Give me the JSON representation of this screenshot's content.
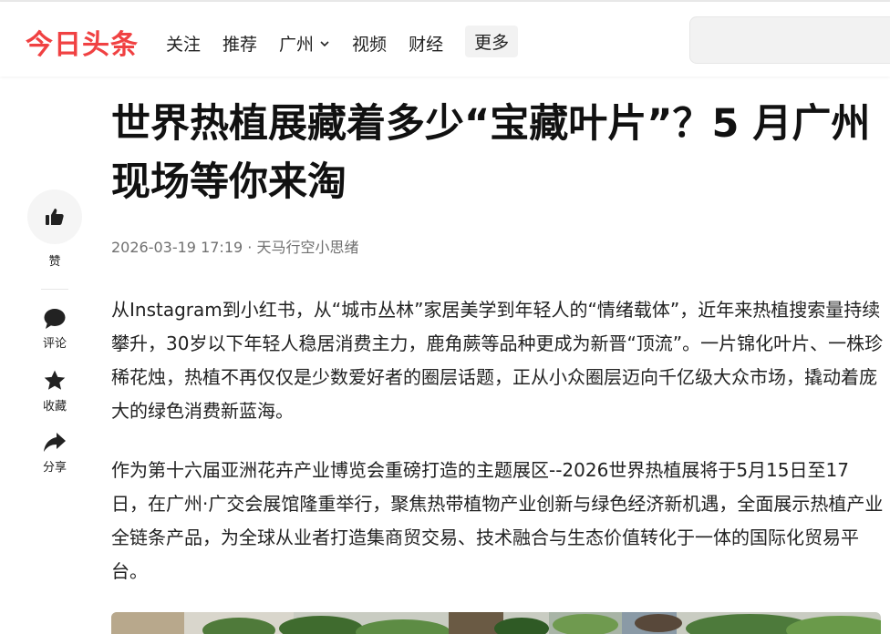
{
  "header": {
    "logo": "今日头条",
    "nav": [
      {
        "label": "关注"
      },
      {
        "label": "推荐"
      },
      {
        "label": "广州"
      },
      {
        "label": "视频"
      },
      {
        "label": "财经"
      }
    ],
    "more_label": "更多"
  },
  "sidebar": {
    "like_label": "赞",
    "comment_label": "评论",
    "collect_label": "收藏",
    "share_label": "分享"
  },
  "article": {
    "title": "世界热植展藏着多少“宝藏叶片”？5 月广州现场等你来淘",
    "date": "2026-03-19 17:19",
    "author": "天马行空小思绪",
    "paragraphs": [
      "从Instagram到小红书，从“城市丛林”家居美学到年轻人的“情绪载体”，近年来热植搜索量持续攀升，30岁以下年轻人稳居消费主力，鹿角蕨等品种更成为新晋“顶流”。一片锦化叶片、一株珍稀花烛，热植不再仅仅是少数爱好者的圈层话题，正从小众圈层迈向千亿级大众市场，撬动着庞大的绿色消费新蓝海。",
      "作为第十六届亚洲花卉产业博览会重磅打造的主题展区--2026世界热植展将于5月15日至17日，在广州·广交会展馆隆重举行，聚焦热带植物产业创新与绿色经济新机遇，全面展示热植产业全链条产品，为全球从业者打造集商贸交易、技术融合与生态价值转化于一体的国际化贸易平台。"
    ]
  },
  "colors": {
    "brand": "#f04142",
    "text": "#222222",
    "meta": "#707070"
  },
  "icons": [
    "thumbs-up-icon",
    "comment-icon",
    "star-icon",
    "share-icon",
    "chevron-down-icon"
  ]
}
